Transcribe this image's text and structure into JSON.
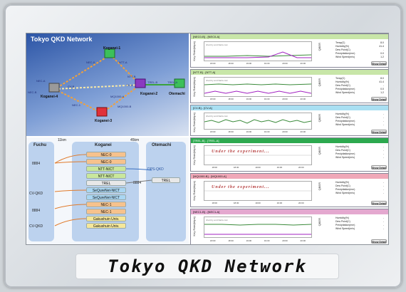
{
  "caption": "Tokyo QKD Network",
  "map": {
    "title": "Tokyo QKD Network",
    "nodes": [
      "Koganei-1",
      "Koganei-4",
      "Koganei-2",
      "Koganei-3",
      "Otemachi"
    ],
    "links": [
      "NEC-0",
      "NTT-A",
      "NEC-A",
      "NEC-B",
      "CV-B",
      "NTT-B",
      "MQ1000-A",
      "CV-A",
      "TREL-B",
      "TREL-A",
      "NEC-1",
      "MQ1000-B"
    ]
  },
  "topology": {
    "sites": [
      "Fuchu",
      "Koganei",
      "Otemachi"
    ],
    "distances": [
      "11km",
      "45km"
    ],
    "left_labels": [
      "8884",
      "CV-QKD",
      "8884",
      "CV-QKD"
    ],
    "koganei_devices": [
      "NEC-0",
      "NEC-0",
      "NTT-NICT",
      "NTT-NICT",
      "TREL",
      "SeQureNet-NICT",
      "SeQureNet-NICT",
      "NEC-1",
      "NEC-1",
      "Gakushuin Univ.",
      "Gakushuin Univ."
    ],
    "otemachi_devices": [
      "DPS-QKD",
      "8884",
      "TREL"
    ]
  },
  "panels": [
    {
      "header": "[NEC0-B] - [NEC0-A]",
      "credit": "chart by amCharts.com",
      "ylabel": "Key Rate(kbps)",
      "yticks": [
        "250",
        "200",
        "150",
        "100",
        "50",
        "0"
      ],
      "xticks": [
        "18:00",
        "18:30",
        "19:00",
        "19:30",
        "20:00",
        "20:30"
      ],
      "rlabel": "QBER",
      "stats": [
        [
          "Temp(C)",
          "8.0"
        ],
        [
          "Humidity(%)",
          "41.4"
        ],
        [
          "Dew Point(C)",
          "-"
        ],
        [
          "Precipitation(mm)",
          "0.0"
        ],
        [
          "Wind Speed(m/s)",
          "1.2"
        ]
      ],
      "button": "Show Detail"
    },
    {
      "header": "[NTT-B] - [NTT-A]",
      "credit": "chart by amCharts.com",
      "ylabel": "Key Rate(kbps)",
      "yticks": [
        "300",
        "250",
        "200",
        "150",
        "100",
        "50"
      ],
      "xticks": [
        "18:00",
        "18:30",
        "19:00",
        "19:30",
        "20:00",
        "20:30"
      ],
      "rlabel": "QBER",
      "stats": [
        [
          "Temp(C)",
          "8.0"
        ],
        [
          "Humidity(%)",
          "41.4"
        ],
        [
          "Dew Point(C)",
          "-"
        ],
        [
          "Precipitation(mm)",
          "0.0"
        ],
        [
          "Wind Speed(m/s)",
          "1.2"
        ]
      ],
      "button": "Show Detail"
    },
    {
      "header": "[CV-B] - [CV-A]",
      "credit": "chart by amCharts.com",
      "ylabel": "Key Rate(kbps)",
      "yticks": [
        "16",
        "14",
        "12",
        "10"
      ],
      "xticks": [
        "18:00",
        "18:30",
        "19:00",
        "19:30",
        "20:00",
        "20:30"
      ],
      "rlabel": "QBER",
      "stats": [
        [
          "Humidity(%)",
          "-"
        ],
        [
          "Dew Point(C)",
          "-"
        ],
        [
          "Precipitation(mm)",
          "-"
        ],
        [
          "Wind Speed(m/s)",
          "-"
        ]
      ],
      "button": "Show Detail"
    },
    {
      "header": "[TREL-B] - [TREL-A]",
      "overlay": "Under the experiment...",
      "ylabel": "Key Rate(kbps)",
      "yticks": [
        "1",
        "0.5",
        "0"
      ],
      "xticks": [
        "18:00",
        "18:30",
        "19:00",
        "19:30",
        "20:00"
      ],
      "rlabel": "QBER",
      "stats": [
        [
          "Humidity(%)",
          "-"
        ],
        [
          "Dew Point(C)",
          "-"
        ],
        [
          "Precipitation(mm)",
          "-"
        ],
        [
          "Wind Speed(m/s)",
          "-"
        ]
      ],
      "button": "Show Detail"
    },
    {
      "header": "[MQ1000-B] - [MQ1000-A]",
      "overlay": "Under the experiment...",
      "ylabel": "Key Rate(kbps)",
      "yticks": [
        "1",
        "0.5",
        "0"
      ],
      "xticks": [
        "18:00",
        "18:30",
        "19:00",
        "19:30",
        "20:00"
      ],
      "rlabel": "QBER",
      "stats": [
        [
          "Humidity(%)",
          "-"
        ],
        [
          "Dew Point(C)",
          "-"
        ],
        [
          "Precipitation(mm)",
          "-"
        ],
        [
          "Wind Speed(m/s)",
          "-"
        ]
      ],
      "button": "Show Detail"
    },
    {
      "header": "[NEC1-B] - [NEC1-A]",
      "credit": "chart by amCharts.com",
      "ylabel": "Key Rate(kbps)",
      "yticks": [
        "300",
        "250",
        "200",
        "150",
        "100",
        "50"
      ],
      "xticks": [
        "18:00",
        "18:30",
        "19:00",
        "19:30",
        "20:00",
        "20:30"
      ],
      "rlabel": "QBER",
      "stats": [
        [
          "Humidity(%)",
          "-"
        ],
        [
          "Dew Point(C)",
          "-"
        ],
        [
          "Precipitation(mm)",
          "-"
        ],
        [
          "Wind Speed(m/s)",
          "-"
        ]
      ],
      "button": "Show Detail"
    }
  ]
}
